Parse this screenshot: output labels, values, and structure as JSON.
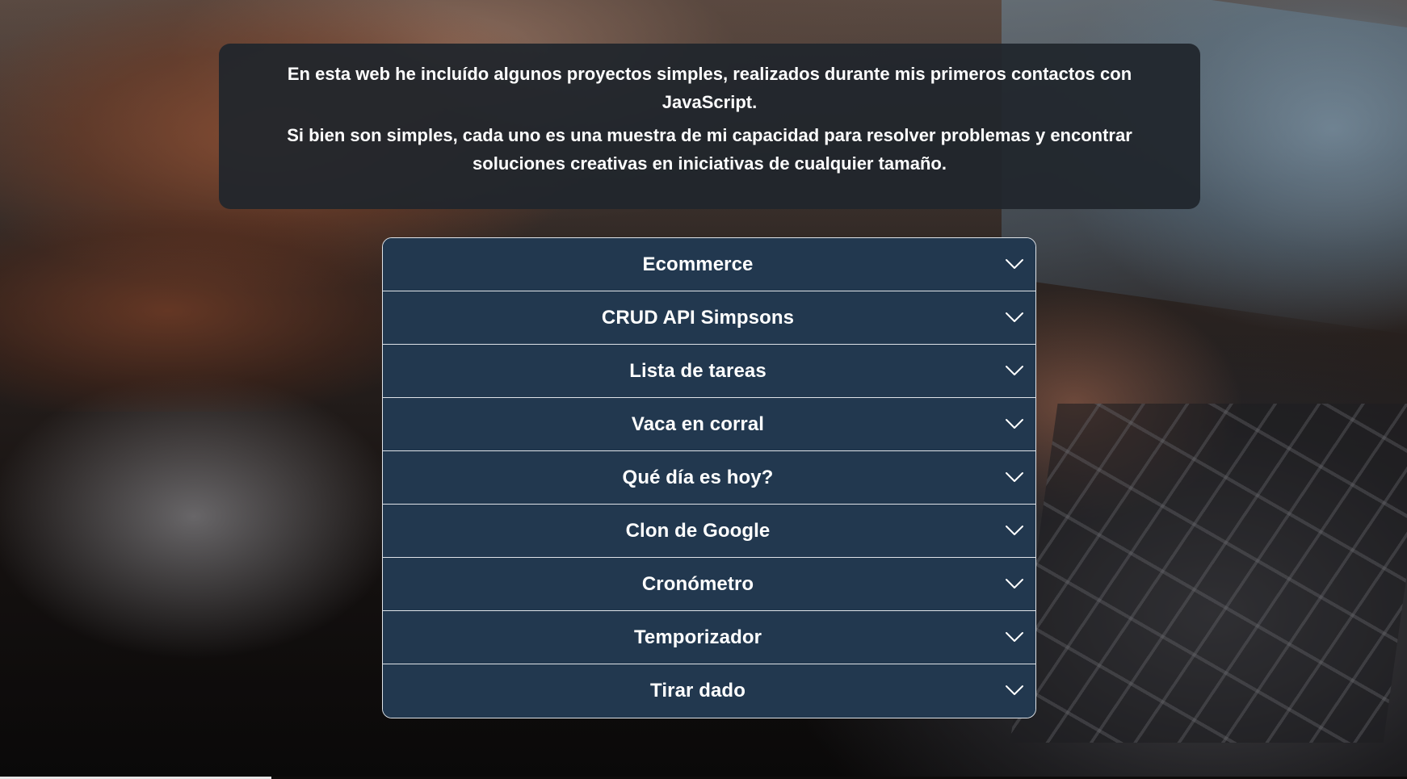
{
  "intro": {
    "line1": "En esta web he incluído algunos proyectos simples, realizados durante mis primeros contactos con JavaScript.",
    "line2": "Si bien son simples, cada uno es una muestra de mi capacidad para resolver problemas y encontrar soluciones creativas en iniciativas de cualquier tamaño."
  },
  "projects": [
    {
      "title": "Ecommerce",
      "icon": "chevron-down-icon"
    },
    {
      "title": "CRUD API Simpsons",
      "icon": "chevron-down-icon"
    },
    {
      "title": "Lista de tareas",
      "icon": "chevron-down-icon"
    },
    {
      "title": "Vaca en corral",
      "icon": "chevron-down-icon"
    },
    {
      "title": "Qué día es hoy?",
      "icon": "chevron-down-icon"
    },
    {
      "title": "Clon de Google",
      "icon": "chevron-down-icon"
    },
    {
      "title": "Cronómetro",
      "icon": "chevron-down-icon"
    },
    {
      "title": "Temporizador",
      "icon": "chevron-down-icon"
    },
    {
      "title": "Tirar dado",
      "icon": "chevron-down-icon"
    }
  ],
  "colors": {
    "accordion_bg": "#22384f",
    "intro_bg": "#20262c",
    "border": "#dfe3e8",
    "text": "#ffffff"
  }
}
